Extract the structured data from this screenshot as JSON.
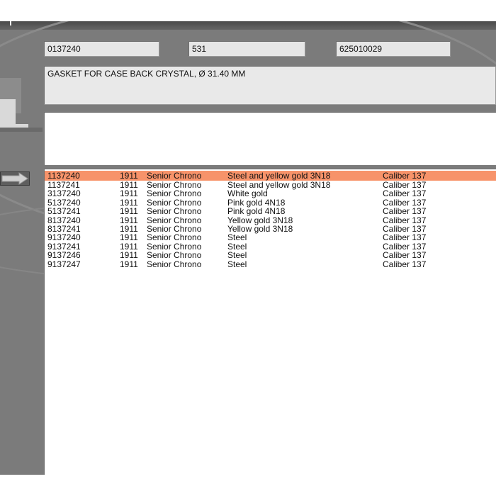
{
  "header": {
    "field_ref": "0137240",
    "field_code": "531",
    "field_num": "625010029"
  },
  "description": "GASKET FOR CASE BACK CRYSTAL, Ø 31.40 MM",
  "list": {
    "rows": [
      {
        "ref": "1137240",
        "year": "1911",
        "model": "Senior Chrono",
        "material": "Steel and yellow gold 3N18",
        "caliber": "Caliber 137"
      },
      {
        "ref": "1137241",
        "year": "1911",
        "model": "Senior Chrono",
        "material": "Steel and yellow gold 3N18",
        "caliber": "Caliber 137"
      },
      {
        "ref": "3137240",
        "year": "1911",
        "model": "Senior Chrono",
        "material": "White gold",
        "caliber": "Caliber 137"
      },
      {
        "ref": "5137240",
        "year": "1911",
        "model": "Senior Chrono",
        "material": "Pink gold 4N18",
        "caliber": "Caliber 137"
      },
      {
        "ref": "5137241",
        "year": "1911",
        "model": "Senior Chrono",
        "material": "Pink gold 4N18",
        "caliber": "Caliber 137"
      },
      {
        "ref": "8137240",
        "year": "1911",
        "model": "Senior Chrono",
        "material": "Yellow gold 3N18",
        "caliber": "Caliber 137"
      },
      {
        "ref": "8137241",
        "year": "1911",
        "model": "Senior Chrono",
        "material": "Yellow gold 3N18",
        "caliber": "Caliber 137"
      },
      {
        "ref": "9137240",
        "year": "1911",
        "model": "Senior Chrono",
        "material": "Steel",
        "caliber": "Caliber 137"
      },
      {
        "ref": "9137241",
        "year": "1911",
        "model": "Senior Chrono",
        "material": "Steel",
        "caliber": "Caliber 137"
      },
      {
        "ref": "9137246",
        "year": "1911",
        "model": "Senior Chrono",
        "material": "Steel",
        "caliber": "Caliber 137"
      },
      {
        "ref": "9137247",
        "year": "1911",
        "model": "Senior Chrono",
        "material": "Steel",
        "caliber": "Caliber 137"
      }
    ]
  },
  "colors": {
    "selection": "#f7936a",
    "panel": "#7b7b7b"
  },
  "icons": {
    "nav_arrow": "arrow-right-icon"
  }
}
